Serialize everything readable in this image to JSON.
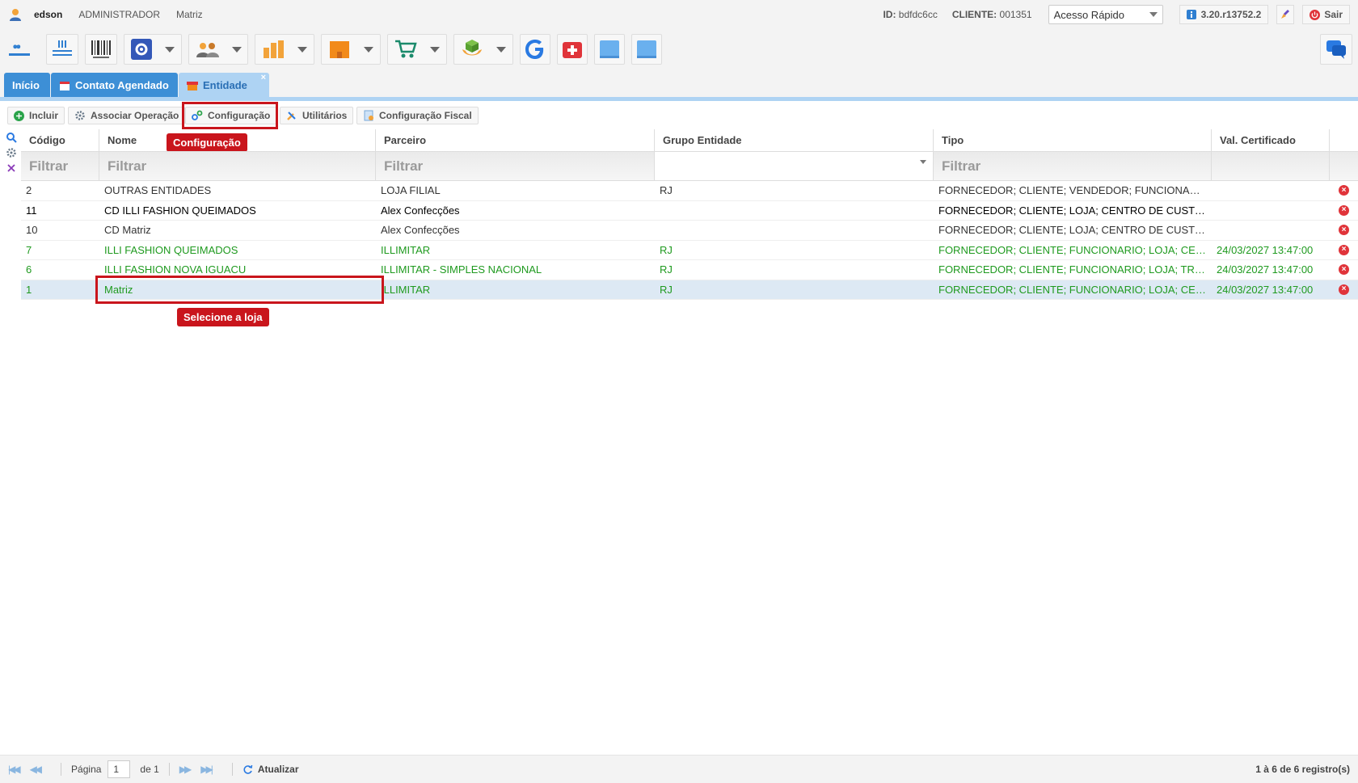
{
  "topbar": {
    "username": "edson",
    "role": "ADMINISTRADOR",
    "unit": "Matriz",
    "id_label": "ID:",
    "id_value": "bdfdc6cc",
    "client_label": "CLIENTE:",
    "client_value": "001351",
    "quick_access": "Acesso Rápido",
    "version": "3.20.r13752.2",
    "exit": "Sair"
  },
  "tabs": [
    {
      "label": "Início"
    },
    {
      "label": "Contato Agendado"
    },
    {
      "label": "Entidade",
      "close": "×"
    }
  ],
  "actions": {
    "incluir": "Incluir",
    "associar": "Associar Operação",
    "configuracao": "Configuração",
    "utilitarios": "Utilitários",
    "fiscal": "Configuração Fiscal"
  },
  "annotations": {
    "config_callout": "Configuração",
    "select_callout": "Selecione a loja"
  },
  "grid": {
    "headers": [
      "Código",
      "Nome",
      "Parceiro",
      "Grupo Entidade",
      "Tipo",
      "Val. Certificado"
    ],
    "filter_placeholder": "Filtrar",
    "rows": [
      {
        "codigo": "2",
        "nome": "OUTRAS ENTIDADES",
        "parceiro": "LOJA FILIAL",
        "grupo": "RJ",
        "tipo": "FORNECEDOR; CLIENTE; VENDEDOR; FUNCIONARI...",
        "cert": ""
      },
      {
        "codigo": "11",
        "nome": "CD ILLI FASHION QUEIMADOS",
        "parceiro": "Alex Confecções",
        "grupo": "",
        "tipo": "FORNECEDOR; CLIENTE; LOJA; CENTRO DE CUSTO...",
        "cert": ""
      },
      {
        "codigo": "10",
        "nome": "CD Matriz",
        "parceiro": "Alex Confecções",
        "grupo": "",
        "tipo": "FORNECEDOR; CLIENTE; LOJA; CENTRO DE CUSTO...",
        "cert": ""
      },
      {
        "codigo": "7",
        "nome": "ILLI FASHION QUEIMADOS",
        "parceiro": "ILLIMITAR",
        "grupo": "RJ",
        "tipo": "FORNECEDOR; CLIENTE; FUNCIONARIO; LOJA; CEN...",
        "cert": "24/03/2027 13:47:00"
      },
      {
        "codigo": "6",
        "nome": "ILLI FASHION NOVA IGUACU",
        "parceiro": "ILLIMITAR - SIMPLES NACIONAL",
        "grupo": "RJ",
        "tipo": "FORNECEDOR; CLIENTE; FUNCIONARIO; LOJA; TRA...",
        "cert": "24/03/2027 13:47:00"
      },
      {
        "codigo": "1",
        "nome": "Matriz",
        "parceiro": "ILLIMITAR",
        "grupo": "RJ",
        "tipo": "FORNECEDOR; CLIENTE; FUNCIONARIO; LOJA; CEN...",
        "cert": "24/03/2027 13:47:00"
      }
    ]
  },
  "footer": {
    "page_label": "Página",
    "page_value": "1",
    "of_label": "de 1",
    "refresh": "Atualizar",
    "count": "1 à 6 de 6 registro(s)"
  },
  "colors": {
    "tab_active": "#3d8fd6",
    "tab_current": "#aed3f3",
    "highlight": "#c9151c",
    "green_row": "#1f9a1f"
  }
}
